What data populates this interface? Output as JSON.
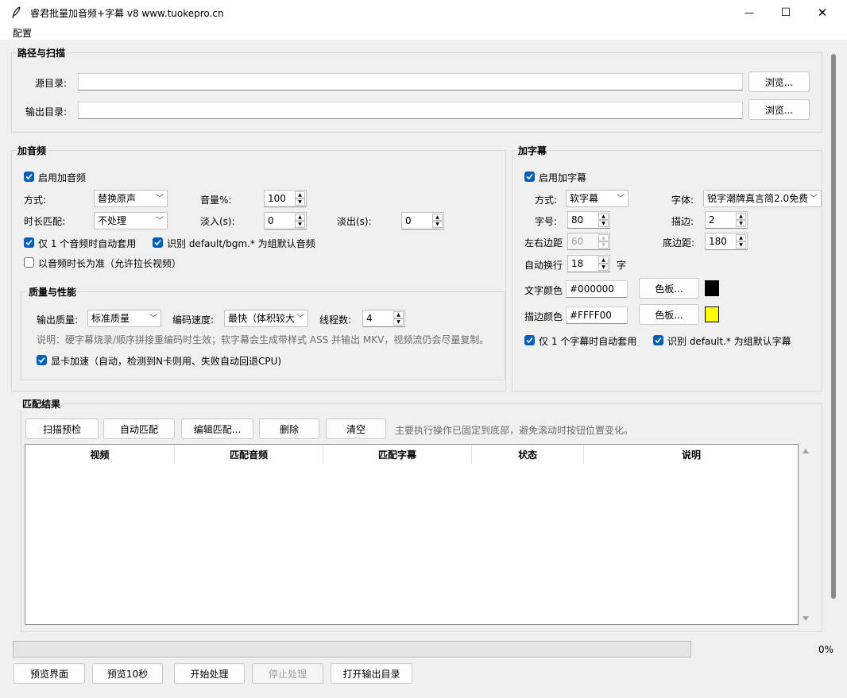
{
  "window": {
    "title": "睿君批量加音频+字幕 v8   www.tuokepro.cn",
    "controls": {
      "minimize": "—",
      "maximize": "☐",
      "close": "✕"
    }
  },
  "menu": {
    "config": "配置"
  },
  "path_scan": {
    "title": "路径与扫描",
    "source_label": "源目录:",
    "source_value": "",
    "output_label": "输出目录:",
    "output_value": "",
    "browse_label": "浏览..."
  },
  "audio": {
    "title": "加音频",
    "enable_label": "启用加音频",
    "enable_checked": true,
    "mode_label": "方式:",
    "mode_value": "替换原声",
    "volume_label": "音量%:",
    "volume_value": "100",
    "duration_label": "时长匹配:",
    "duration_value": "不处理",
    "fadein_label": "淡入(s):",
    "fadein_value": "0",
    "fadeout_label": "淡出(s):",
    "fadeout_value": "0",
    "auto_single_label": "仅 1 个音频时自动套用",
    "auto_single_checked": true,
    "default_bgm_label": "识别 default/bgm.* 为组默认音频",
    "default_bgm_checked": true,
    "audio_length_label": "以音频时长为准（允许拉长视频）",
    "audio_length_checked": false
  },
  "quality": {
    "title": "质量与性能",
    "output_quality_label": "输出质量:",
    "output_quality_value": "标准质量",
    "encode_speed_label": "编码速度:",
    "encode_speed_value": "最快（体积较大",
    "threads_label": "线程数:",
    "threads_value": "4",
    "note": "说明：硬字幕烧录/顺序拼接重编码时生效；软字幕会生成带样式 ASS 并输出 MKV，视频流仍会尽量复制。",
    "gpu_label": "显卡加速（自动，检测到N卡则用、失败自动回退CPU)",
    "gpu_checked": true
  },
  "subtitle": {
    "title": "加字幕",
    "enable_label": "启用加字幕",
    "enable_checked": true,
    "mode_label": "方式:",
    "mode_value": "软字幕",
    "font_label": "字体:",
    "font_value": "锐字潮牌真言简2.0免费",
    "size_label": "字号:",
    "size_value": "80",
    "stroke_label": "描边:",
    "stroke_value": "2",
    "lr_margin_label": "左右边距",
    "lr_margin_value": "60",
    "bottom_margin_label": "底边距:",
    "bottom_margin_value": "180",
    "wrap_label": "自动换行",
    "wrap_value": "18",
    "wrap_unit": "字",
    "text_color_label": "文字颜色",
    "text_color_value": "#000000",
    "stroke_color_label": "描边颜色",
    "stroke_color_value": "#FFFF00",
    "palette_label": "色板...",
    "auto_single_label": "仅 1 个字幕时自动套用",
    "auto_single_checked": true,
    "default_label": "识别 default.* 为组默认字幕",
    "default_checked": true
  },
  "match": {
    "title": "匹配结果",
    "buttons": {
      "scan": "扫描预检",
      "auto": "自动匹配",
      "edit": "编辑匹配...",
      "delete": "删除",
      "clear": "清空"
    },
    "hint": "主要执行操作已固定到底部，避免滚动时按钮位置变化。",
    "columns": [
      "视频",
      "匹配音频",
      "匹配字幕",
      "状态",
      "说明"
    ]
  },
  "bottom": {
    "progress_percent": 0,
    "progress_text": "0%",
    "buttons": {
      "preview_ui": "预览界面",
      "preview_10s": "预览10秒",
      "start": "开始处理",
      "stop": "停止处理",
      "open_output": "打开输出目录"
    }
  },
  "colors": {
    "accent": "#005fb8",
    "text_color_swatch": "#000000",
    "stroke_color_swatch": "#FFFF00"
  }
}
